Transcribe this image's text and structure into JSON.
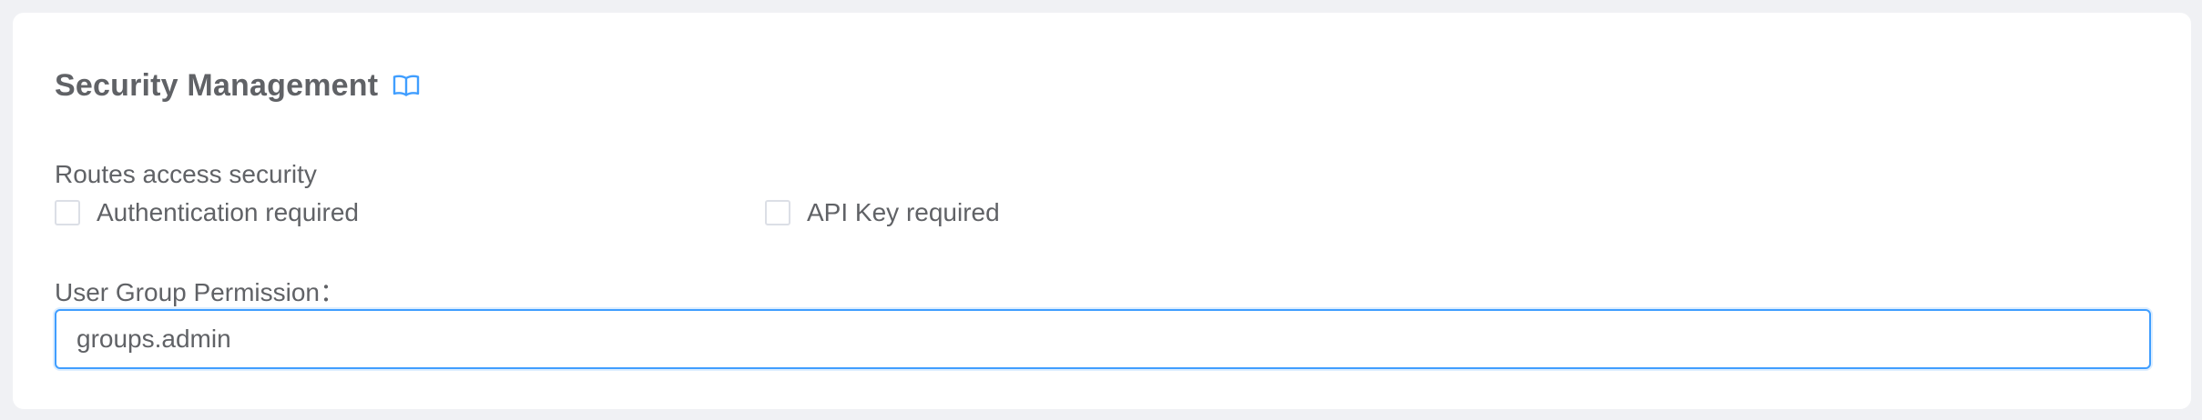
{
  "section": {
    "title": "Security Management",
    "doc_icon": "book-open-icon",
    "accent_color": "#409eff"
  },
  "routes_security": {
    "label": "Routes access security",
    "options": [
      {
        "label": "Authentication required",
        "checked": false
      },
      {
        "label": "API Key required",
        "checked": false
      }
    ]
  },
  "user_group": {
    "label": "User Group Permission：",
    "value": "groups.admin",
    "focused": true
  }
}
